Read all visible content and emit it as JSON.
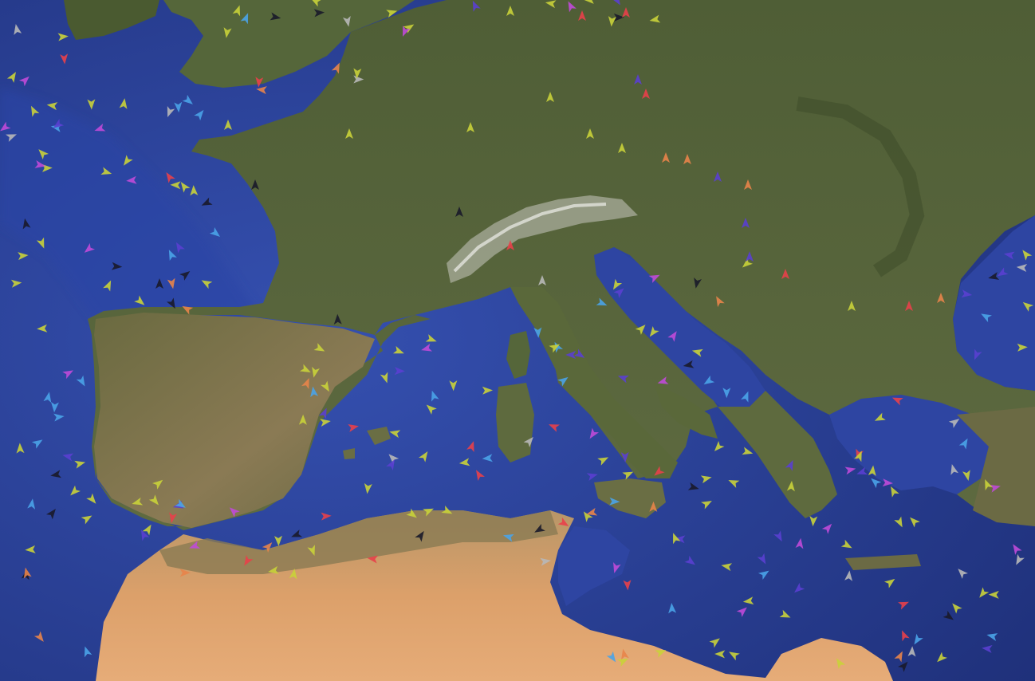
{
  "map": {
    "type": "satellite-vessel-tracking",
    "region": "western-and-central-mediterranean",
    "colors": {
      "sea_deep": "#22357f",
      "sea": "#2d43a0",
      "sea_shallow": "#3d5bb8",
      "land_forest": "#4a5a32",
      "land_green": "#5b6a3c",
      "land_dry": "#8a7a52",
      "land_mountain": "#9a9a8a",
      "desert": "#d89a66",
      "desert_light": "#e2aa74",
      "snow": "#e8e8e8"
    },
    "vessel_colors": {
      "cargo": "#c9d23a",
      "passenger": "#4aa3e8",
      "tanker": "#e8404a",
      "fishing": "#e8844a",
      "tug": "#c04ad8",
      "highspeed": "#5a3fd0",
      "unknown": "#1a1a2a",
      "other": "#b8b8b8"
    },
    "vessels": [
      {
        "type": "passenger"
      },
      {
        "type": "cargo"
      },
      {
        "type": "cargo"
      },
      {
        "type": "passenger"
      },
      {
        "type": "cargo"
      },
      {
        "type": "cargo"
      },
      {
        "type": "tanker"
      },
      {
        "type": "cargo"
      },
      {
        "type": "passenger"
      },
      {
        "type": "cargo"
      },
      {
        "type": "cargo"
      },
      {
        "type": "passenger"
      },
      {
        "type": "tug"
      },
      {
        "type": "cargo"
      },
      {
        "type": "passenger"
      },
      {
        "type": "cargo"
      },
      {
        "type": "tanker"
      },
      {
        "type": "cargo"
      },
      {
        "type": "passenger"
      },
      {
        "type": "cargo"
      },
      {
        "type": "fishing"
      },
      {
        "type": "tanker"
      },
      {
        "type": "highspeed"
      },
      {
        "type": "tanker"
      },
      {
        "type": "fishing"
      },
      {
        "type": "fishing"
      },
      {
        "type": "highspeed"
      },
      {
        "type": "tanker"
      },
      {
        "type": "tanker"
      },
      {
        "type": "tug"
      },
      {
        "type": "unknown"
      },
      {
        "type": "other"
      },
      {
        "type": "tanker"
      },
      {
        "type": "fishing"
      },
      {
        "type": "passenger"
      },
      {
        "type": "cargo"
      },
      {
        "type": "tanker"
      },
      {
        "type": "passenger"
      },
      {
        "type": "tug"
      },
      {
        "type": "highspeed"
      },
      {
        "type": "fishing"
      },
      {
        "type": "passenger"
      },
      {
        "type": "cargo"
      },
      {
        "type": "tanker"
      },
      {
        "type": "unknown"
      }
    ]
  }
}
